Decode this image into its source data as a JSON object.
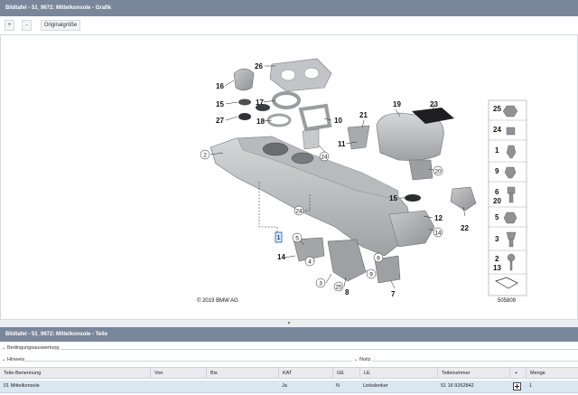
{
  "graphic_panel": {
    "title": "Bildtafel - 51_9672: Mittelkonsole - Grafik",
    "zoom_in": "+",
    "zoom_out": "-",
    "original_size": "Originalgröße"
  },
  "diagram": {
    "copyright": "© 2019 BMW AG",
    "image_number": "505809",
    "callouts": [
      "26",
      "16",
      "15",
      "17",
      "27",
      "18",
      "10",
      "19",
      "23",
      "21",
      "2",
      "11",
      "24",
      "20",
      "15",
      "12",
      "22",
      "24",
      "1",
      "5",
      "14",
      "4",
      "6",
      "9",
      "3",
      "25",
      "8",
      "7"
    ],
    "sidebar_parts": [
      "25",
      "24",
      "1",
      "9",
      "6",
      "20",
      "5",
      "3",
      "2",
      "13"
    ]
  },
  "parts_panel": {
    "title": "Bildtafel - 51_9672: Mittelkonsole - Teile",
    "condition_label": "Bedingungsauswertung",
    "hint_label": "Hinweis",
    "note_label": "Notiz"
  },
  "table": {
    "columns": [
      "Teile-Benennung",
      "Von",
      "Bis",
      "KAT",
      "GE",
      "LE",
      "Teilenummer",
      "+",
      "Menge"
    ],
    "rows": [
      {
        "name": "01 Mittelkonsole",
        "von": "",
        "bis": "",
        "kat": "Ja",
        "ge": "N",
        "le": "Linkslenker",
        "part_number": "51 16 9262842",
        "qty": "1"
      }
    ]
  },
  "colors": {
    "header_bg": "#7a8699",
    "row_selected": "#dbe6f3"
  }
}
